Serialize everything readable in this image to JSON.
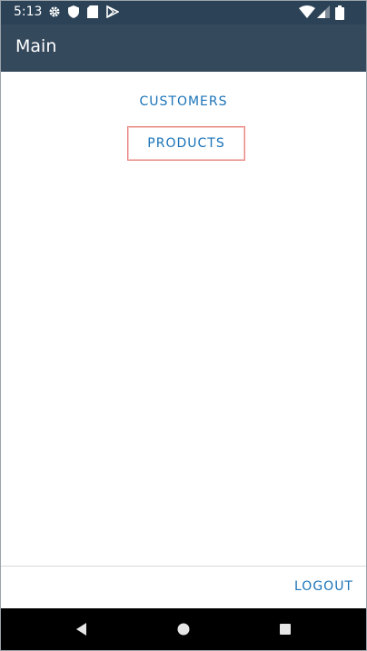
{
  "status_bar": {
    "time": "5:13",
    "left_icons": [
      "gear-icon",
      "shield-icon",
      "sd-card-icon",
      "play-store-icon"
    ],
    "right_icons": [
      "wifi-icon",
      "signal-icon",
      "battery-icon"
    ]
  },
  "app_bar": {
    "title": "Main"
  },
  "content": {
    "customers_label": "CUSTOMERS",
    "products_label": "PRODUCTS"
  },
  "bottom_bar": {
    "logout_label": "LOGOUT"
  },
  "nav_bar": {
    "icons": [
      "back-icon",
      "home-icon",
      "recents-icon"
    ]
  },
  "colors": {
    "status_bar": "#2c4357",
    "app_bar": "#35495d",
    "link": "#1a73b8",
    "highlight_border": "#e8837f"
  }
}
